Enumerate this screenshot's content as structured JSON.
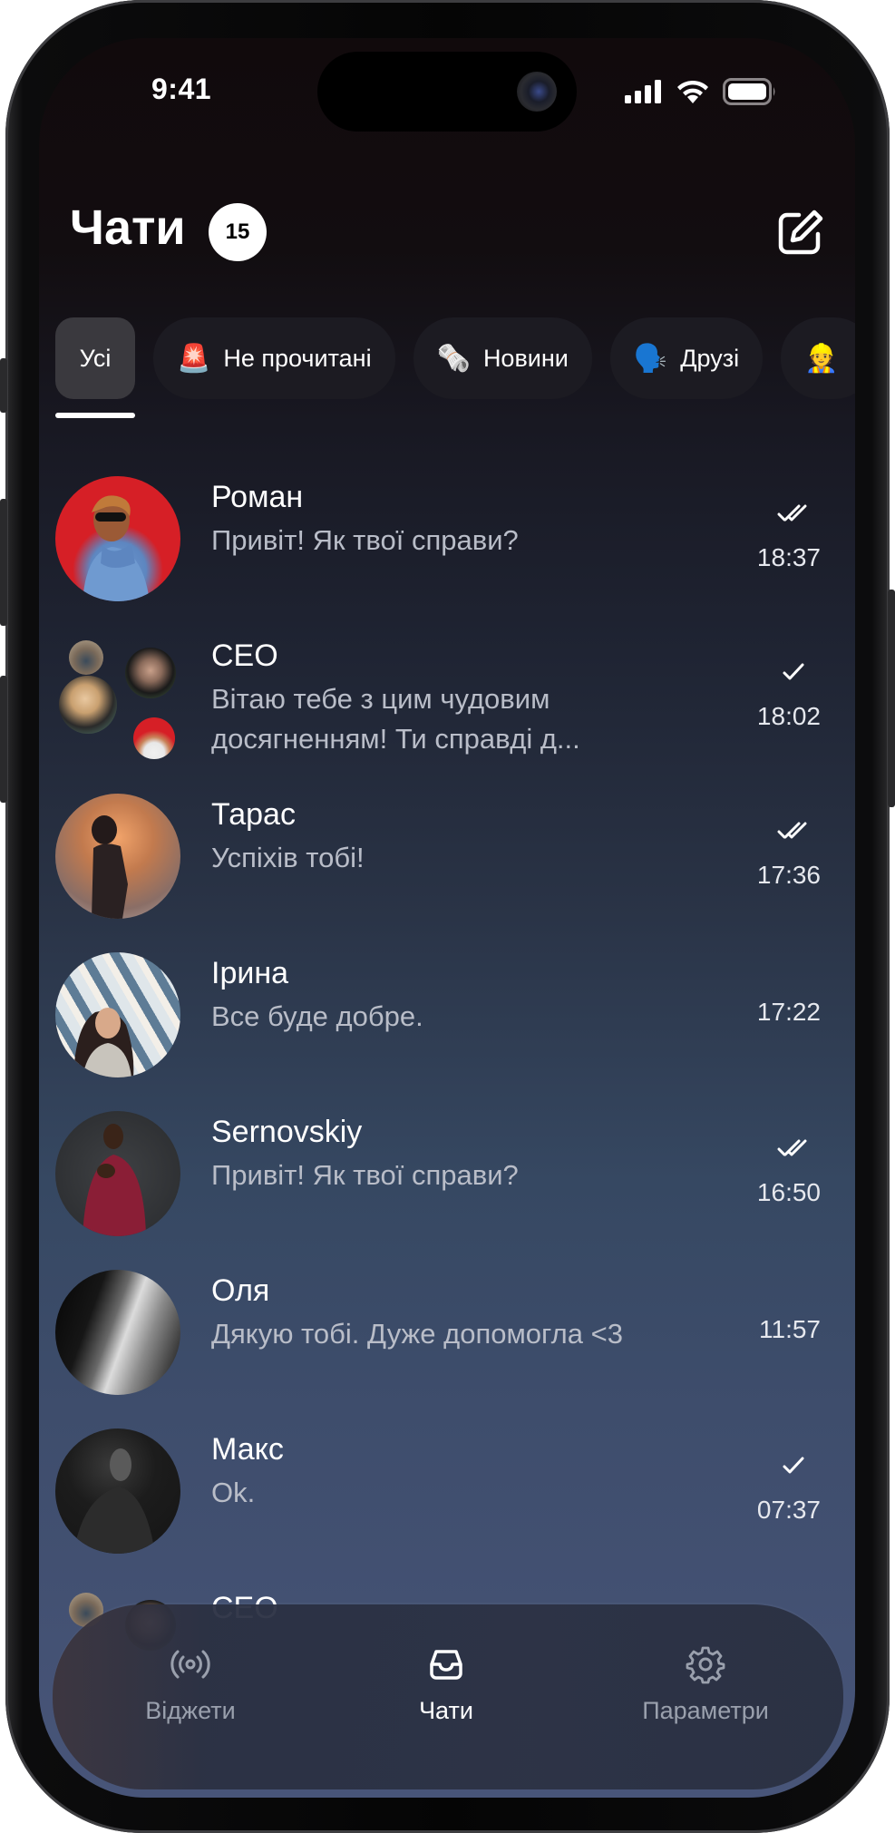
{
  "status_bar": {
    "time": "9:41",
    "icons": [
      "cellular-signal-icon",
      "wifi-icon",
      "battery-icon"
    ]
  },
  "header": {
    "title": "Чати",
    "unread_count": "15",
    "compose_icon": "compose-icon"
  },
  "filters": [
    {
      "label": "Усі",
      "emoji": "",
      "active": true
    },
    {
      "label": "Не прочитані",
      "emoji": "🚨",
      "active": false
    },
    {
      "label": "Новини",
      "emoji": "🗞️",
      "active": false
    },
    {
      "label": "Друзі",
      "emoji": "🗣️",
      "active": false
    },
    {
      "label": "",
      "emoji": "👷",
      "active": false
    }
  ],
  "chats": [
    {
      "name": "Роман",
      "message": "Привіт! Як твої справи?",
      "time": "18:37",
      "status": "read",
      "avatar_color": "#d61f26"
    },
    {
      "name": "CEO",
      "message": "Вітаю тебе з цим чудовим досягненням! Ти справді д...",
      "time": "18:02",
      "status": "sent",
      "group": true
    },
    {
      "name": "Тарас",
      "message": "Успіхів тобі!",
      "time": "17:36",
      "status": "read",
      "avatar_color": "#c27a4e"
    },
    {
      "name": "Ірина",
      "message": "Все буде добре.",
      "time": "17:22",
      "status": "none",
      "avatar_color": "#6f8aa0"
    },
    {
      "name": "Sernovskiy",
      "message": "Привіт! Як твої справи?",
      "time": "16:50",
      "status": "read",
      "avatar_color": "#5a4a4e"
    },
    {
      "name": "Оля",
      "message": "Дякую тобі. Дуже допомогла <3",
      "time": "11:57",
      "status": "none",
      "avatar_color": "#2a2a2a"
    },
    {
      "name": "Макс",
      "message": "Ok.",
      "time": "07:37",
      "status": "sent",
      "avatar_color": "#1c1c1c"
    },
    {
      "name": "CEO",
      "message": "",
      "time": "",
      "status": "none",
      "group": true
    }
  ],
  "tabbar": {
    "items": [
      {
        "label": "Віджети",
        "icon": "broadcast-icon",
        "active": false
      },
      {
        "label": "Чати",
        "icon": "inbox-icon",
        "active": true
      },
      {
        "label": "Параметри",
        "icon": "gear-icon",
        "active": false
      }
    ]
  },
  "colors": {
    "text_primary": "#ffffff",
    "text_secondary": "#b9bdc8",
    "tab_inactive": "#9aa0ad",
    "chip_active": "#3a393e",
    "chip_bg": "#1c1b22"
  }
}
